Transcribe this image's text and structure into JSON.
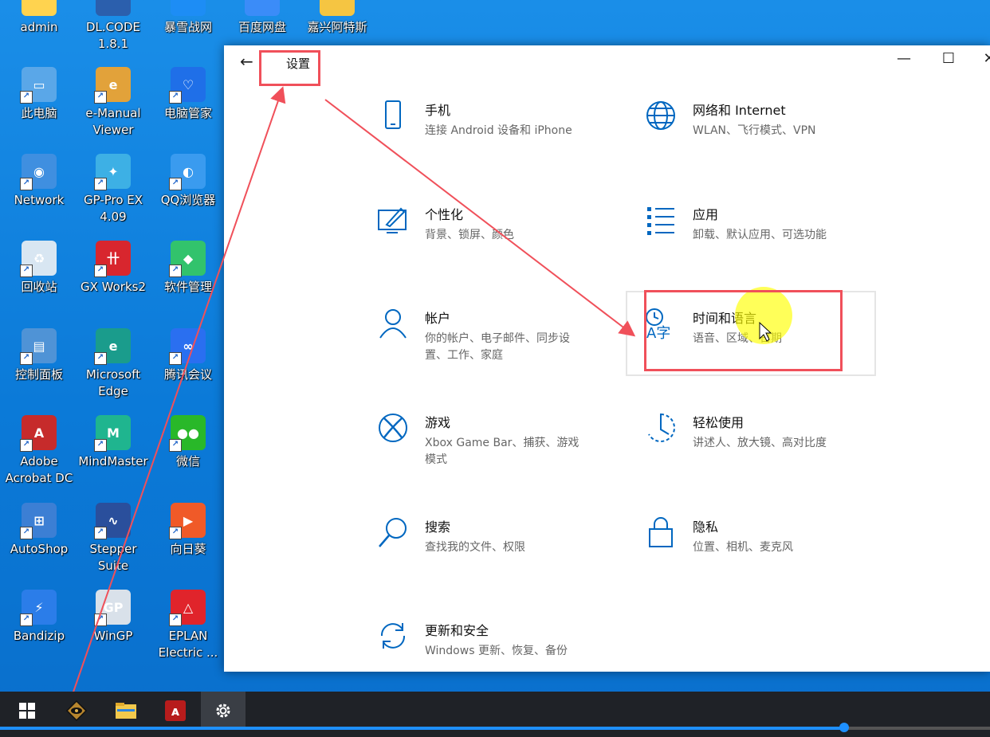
{
  "desktop_icons": [
    {
      "label": "admin",
      "color": "#ffd34f",
      "glyph": ""
    },
    {
      "label": "DL.CODE\n1.8.1",
      "color": "#2b5fad",
      "glyph": ""
    },
    {
      "label": "暴雪战网",
      "color": "#1d8df5",
      "glyph": ""
    },
    {
      "label": "百度网盘",
      "color": "#3b8cf8",
      "glyph": ""
    },
    {
      "label": "嘉兴阿特斯",
      "color": "#f5c542",
      "glyph": ""
    },
    {
      "label": "此电脑",
      "color": "#5aa7e8",
      "glyph": "▭"
    },
    {
      "label": "e-Manual\nViewer",
      "color": "#e2a23a",
      "glyph": "e"
    },
    {
      "label": "电脑管家",
      "color": "#1f6fe8",
      "glyph": "♡"
    },
    {
      "label": "Network",
      "color": "#3f8fe0",
      "glyph": "◉"
    },
    {
      "label": "GP-Pro EX\n4.09",
      "color": "#3db0e5",
      "glyph": "✦"
    },
    {
      "label": "QQ浏览器",
      "color": "#3a9bef",
      "glyph": "◐"
    },
    {
      "label": "回收站",
      "color": "#d8e6f2",
      "glyph": "♻"
    },
    {
      "label": "GX Works2",
      "color": "#d8262e",
      "glyph": "卄"
    },
    {
      "label": "软件管理",
      "color": "#32c36c",
      "glyph": "◆"
    },
    {
      "label": "控制面板",
      "color": "#4f93d6",
      "glyph": "▤"
    },
    {
      "label": "Microsoft\nEdge",
      "color": "#1a9c8c",
      "glyph": "e"
    },
    {
      "label": "腾讯会议",
      "color": "#2a6ff0",
      "glyph": "∞"
    },
    {
      "label": "Adobe\nAcrobat DC",
      "color": "#c62b2b",
      "glyph": "A"
    },
    {
      "label": "MindMaster",
      "color": "#1fb58f",
      "glyph": "M"
    },
    {
      "label": "微信",
      "color": "#29b829",
      "glyph": "●●"
    },
    {
      "label": "AutoShop",
      "color": "#3c7fd4",
      "glyph": "⊞"
    },
    {
      "label": "Stepper\nSuite",
      "color": "#2a4f9c",
      "glyph": "∿"
    },
    {
      "label": "向日葵",
      "color": "#f05a28",
      "glyph": "▶"
    },
    {
      "label": "Bandizip",
      "color": "#2b7de9",
      "glyph": "⚡"
    },
    {
      "label": "WinGP",
      "color": "#d9e1ea",
      "glyph": "GP"
    },
    {
      "label": "EPLAN\nElectric ...",
      "color": "#e0242b",
      "glyph": "△"
    }
  ],
  "window": {
    "title": "设置",
    "back_glyph": "←",
    "minimize_glyph": "—",
    "maximize_glyph": "☐",
    "close_glyph": "✕"
  },
  "tiles": [
    {
      "title": "手机",
      "subtitle": "连接 Android 设备和 iPhone",
      "icon": "phone-icon"
    },
    {
      "title": "网络和 Internet",
      "subtitle": "WLAN、飞行模式、VPN",
      "icon": "globe-icon"
    },
    {
      "title": "个性化",
      "subtitle": "背景、锁屏、颜色",
      "icon": "paint-icon"
    },
    {
      "title": "应用",
      "subtitle": "卸载、默认应用、可选功能",
      "icon": "apps-list-icon"
    },
    {
      "title": "帐户",
      "subtitle": "你的帐户、电子邮件、同步设\n置、工作、家庭",
      "icon": "person-icon"
    },
    {
      "title": "时间和语言",
      "subtitle": "语音、区域、日期",
      "icon": "time-language-icon"
    },
    {
      "title": "游戏",
      "subtitle": "Xbox Game Bar、捕获、游戏\n模式",
      "icon": "xbox-icon"
    },
    {
      "title": "轻松使用",
      "subtitle": "讲述人、放大镜、高对比度",
      "icon": "ease-of-access-icon"
    },
    {
      "title": "搜索",
      "subtitle": "查找我的文件、权限",
      "icon": "search-icon"
    },
    {
      "title": "隐私",
      "subtitle": "位置、相机、麦克风",
      "icon": "lock-icon"
    },
    {
      "title": "更新和安全",
      "subtitle": "Windows 更新、恢复、备份",
      "icon": "sync-icon"
    }
  ],
  "taskbar": {
    "items": [
      "windows-start-icon",
      "app-eye-icon",
      "file-explorer-icon",
      "acrobat-icon",
      "settings-gear-icon"
    ],
    "progress": 0.853
  },
  "colors": {
    "accent": "#0067c0",
    "annotation": "#f0505a",
    "desktop": "#0b7ad8"
  }
}
